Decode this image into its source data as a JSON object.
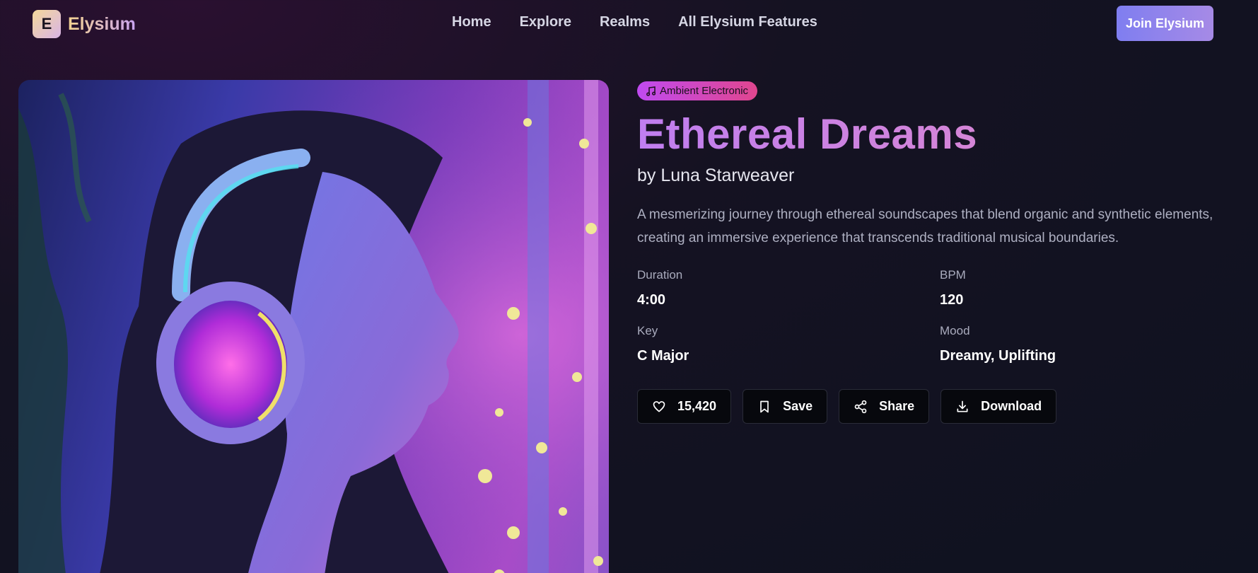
{
  "header": {
    "logo_letter": "E",
    "brand": "Elysium",
    "nav": [
      "Home",
      "Explore",
      "Realms",
      "All Elysium Features"
    ],
    "cta": "Join Elysium"
  },
  "track": {
    "genre": "Ambient Electronic",
    "title": "Ethereal Dreams",
    "artist": "by Luna Starweaver",
    "description": "A mesmerizing journey through ethereal soundscapes that blend organic and synthetic elements, creating an immersive experience that transcends traditional musical boundaries.",
    "stats": [
      {
        "label": "Duration",
        "value": "4:00"
      },
      {
        "label": "BPM",
        "value": "120"
      },
      {
        "label": "Key",
        "value": "C Major"
      },
      {
        "label": "Mood",
        "value": "Dreamy, Uplifting"
      }
    ],
    "actions": {
      "likes": "15,420",
      "save": "Save",
      "share": "Share",
      "download": "Download"
    }
  },
  "icons": {
    "genre": "music-note-icon",
    "like": "heart-icon",
    "save": "bookmark-icon",
    "share": "share-icon",
    "download": "download-icon"
  },
  "colors": {
    "title_gradient": [
      "#c07ef0",
      "#e48ac4"
    ],
    "cta_gradient": [
      "#7f7ef0",
      "#a68ae6"
    ],
    "badge_gradient": [
      "#c04af0",
      "#e0468e"
    ]
  }
}
